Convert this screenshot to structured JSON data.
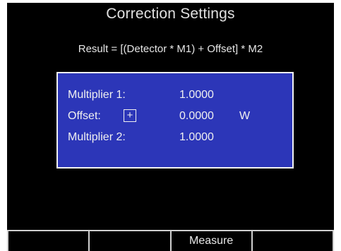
{
  "title": "Correction Settings",
  "formula": "Result = [(Detector * M1) + Offset] * M2",
  "settings": {
    "multiplier1": {
      "label": "Multiplier 1:",
      "value": "1.0000"
    },
    "offset": {
      "label": "Offset:",
      "sign": "+",
      "value": "0.0000",
      "unit": "W"
    },
    "multiplier2": {
      "label": "Multiplier 2:",
      "value": "1.0000"
    }
  },
  "softkeys": [
    "",
    "",
    "Measure",
    ""
  ]
}
